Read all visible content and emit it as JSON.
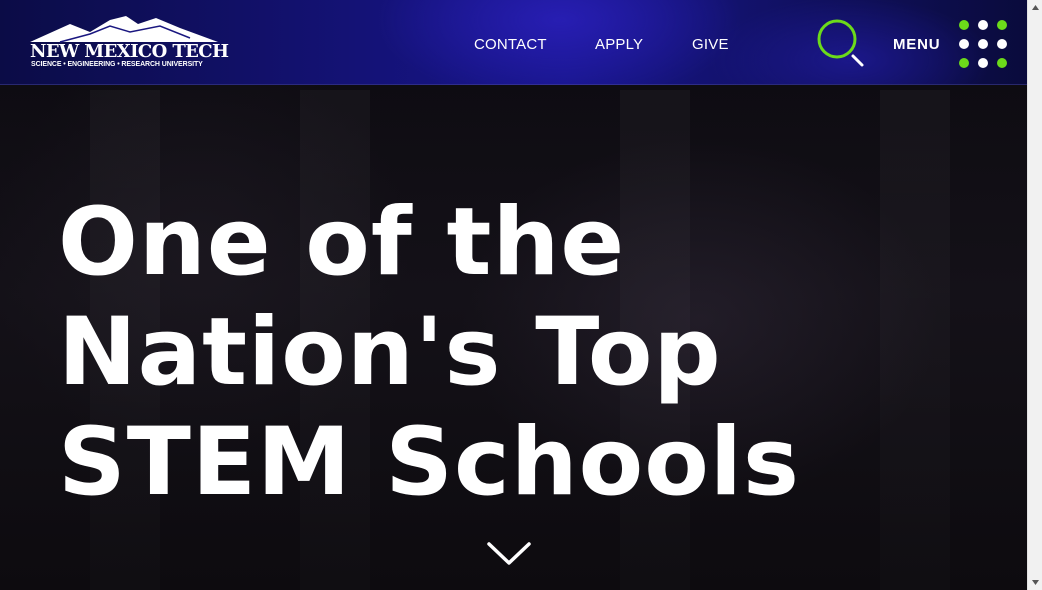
{
  "site": {
    "logo_name": "NEW MEXICO TECH",
    "logo_tagline": "SCIENCE • ENGINEERING • RESEARCH UNIVERSITY"
  },
  "nav": {
    "contact": "CONTACT",
    "apply": "APPLY",
    "give": "GIVE",
    "menu": "MENU"
  },
  "icons": {
    "search": "search-icon",
    "menu": "menu-dots-icon",
    "scroll": "chevron-down-icon"
  },
  "hero": {
    "headline_line1": "One of the",
    "headline_line2": "Nation's Top",
    "headline_line3": "STEM Schools"
  },
  "colors": {
    "accent_green": "#6cdb1a",
    "header_blue": "#17158a",
    "text": "#ffffff"
  }
}
